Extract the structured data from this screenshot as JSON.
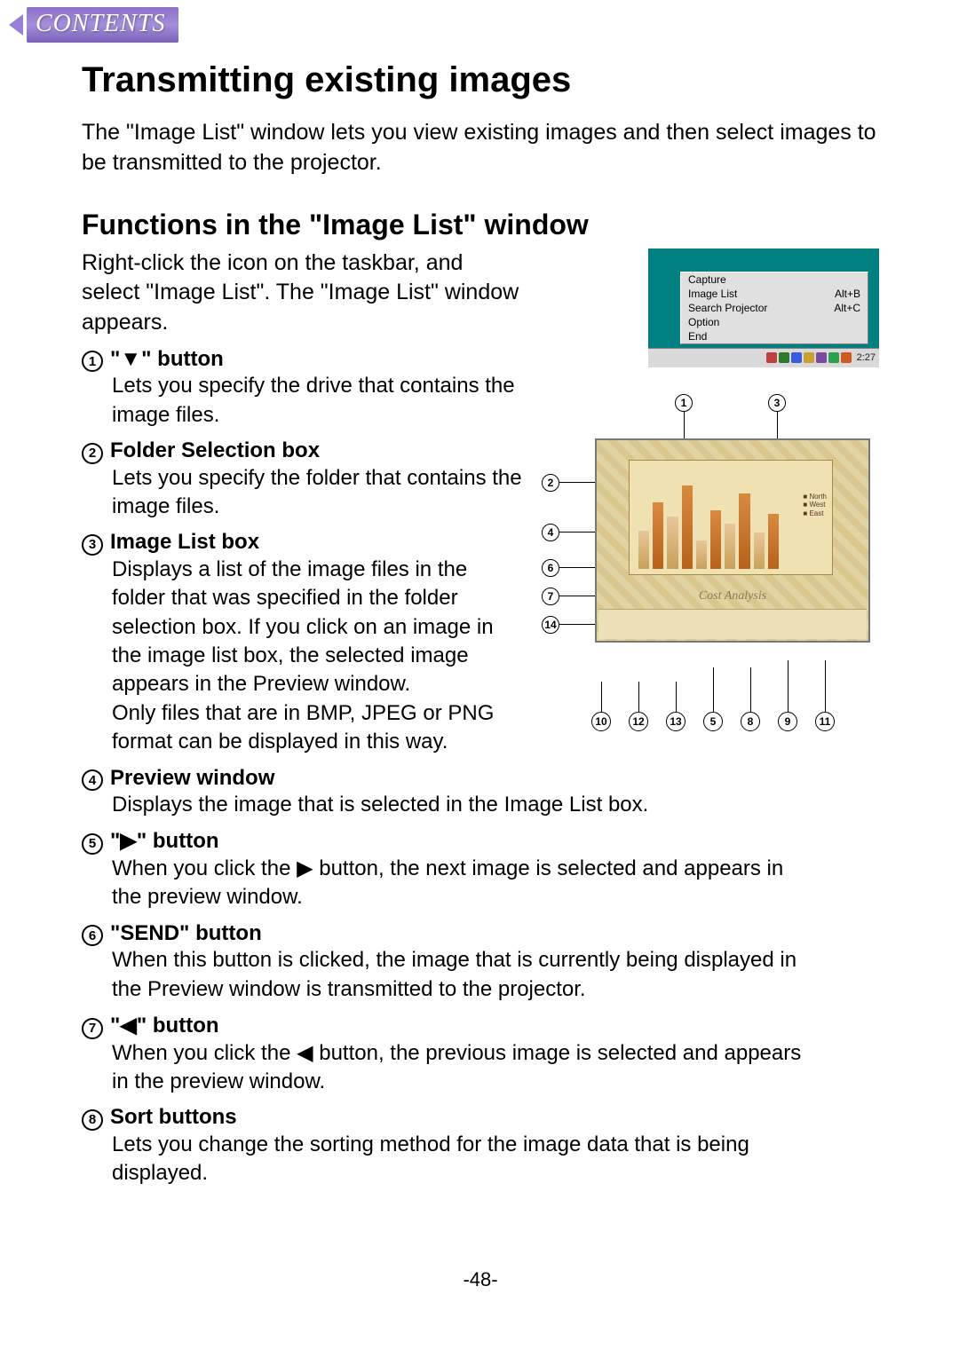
{
  "contents_button": "CONTENTS",
  "title": "Transmitting existing images",
  "intro": "The \"Image List\" window lets you view existing images and then select images to be transmitted to the projector.",
  "section_title": "Functions in the \"Image List\" window",
  "section_intro": "Right-click the icon on the taskbar, and select \"Image List\". The \"Image List\" window appears.",
  "items_top": [
    {
      "num": "1",
      "label": "\"▼\" button",
      "body": "Lets you specify the drive that contains the image files."
    },
    {
      "num": "2",
      "label": "Folder Selection box",
      "body": "Lets you specify the folder that contains the image files."
    },
    {
      "num": "3",
      "label": "Image List box",
      "body": "Displays a list of the image files in the folder that was specified in the folder selection box. If you click on an image in the image list box, the selected image appears in the Preview window.\nOnly files that are in BMP, JPEG or PNG format can be displayed in this way."
    }
  ],
  "items_bottom": [
    {
      "num": "4",
      "label": "Preview window",
      "body": "Displays the image that is selected in the Image List box."
    },
    {
      "num": "5",
      "label": "\"▶\" button",
      "body": "When you click the ▶ button, the next image is selected and appears in the preview window."
    },
    {
      "num": "6",
      "label": "\"SEND\" button",
      "body": "When this button is clicked, the image that is currently being displayed in the Preview window is transmitted to the projector."
    },
    {
      "num": "7",
      "label": "\"◀\" button",
      "body": "When you click the ◀ button, the previous image is selected and appears in the preview window."
    },
    {
      "num": "8",
      "label": "Sort buttons",
      "body": "Lets you change the sorting method for the image data that is being displayed."
    }
  ],
  "context_menu": {
    "items": [
      {
        "label": "Capture",
        "accel": ""
      },
      {
        "label": "Image List",
        "accel": "Alt+B"
      },
      {
        "label": "Search Projector",
        "accel": "Alt+C"
      },
      {
        "label": "Option",
        "accel": ""
      },
      {
        "label": "End",
        "accel": ""
      }
    ],
    "clock": "2:27"
  },
  "annotated_screenshot": {
    "preview_caption": "Cost Analysis",
    "legend": [
      "North",
      "West",
      "East"
    ],
    "callout_top": [
      "1",
      "3"
    ],
    "callout_left": [
      "2",
      "4",
      "6",
      "7",
      "14"
    ],
    "callout_bottom": [
      "10",
      "12",
      "13",
      "5",
      "8",
      "9",
      "11"
    ]
  },
  "page_number": "-48-"
}
